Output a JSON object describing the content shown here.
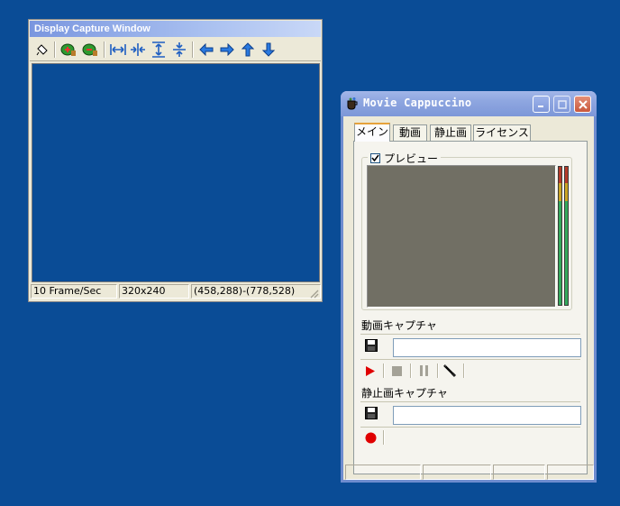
{
  "capture_window": {
    "title": "Display Capture Window",
    "toolbar": {
      "icons": [
        "pointer-icon",
        "add-region-icon",
        "remove-region-icon",
        "stretch-horizontal-icon",
        "shrink-horizontal-icon",
        "stretch-vertical-icon",
        "shrink-vertical-icon",
        "arrow-left-icon",
        "arrow-right-icon",
        "arrow-up-icon",
        "arrow-down-icon"
      ]
    },
    "status": {
      "fps": "10 Frame/Sec",
      "size": "320x240",
      "region": "(458,288)-(778,528)"
    }
  },
  "movie_cappuccino": {
    "title": "Movie Cappuccino",
    "tabs": [
      {
        "label": "メイン",
        "active": true
      },
      {
        "label": "動画",
        "active": false
      },
      {
        "label": "静止画",
        "active": false
      },
      {
        "label": "ライセンス",
        "active": false
      }
    ],
    "preview": {
      "label": "プレビュー",
      "checked": true
    },
    "video_capture": {
      "label": "動画キャプチャ",
      "filename": ""
    },
    "still_capture": {
      "label": "静止画キャプチャ",
      "filename": ""
    }
  },
  "colors": {
    "desktop": "#0a4c96",
    "preview_bg": "#716f64",
    "record_red": "#e00000",
    "meter_green": "#33a85c",
    "meter_yellow": "#c9a325",
    "meter_red": "#b53a2a"
  }
}
